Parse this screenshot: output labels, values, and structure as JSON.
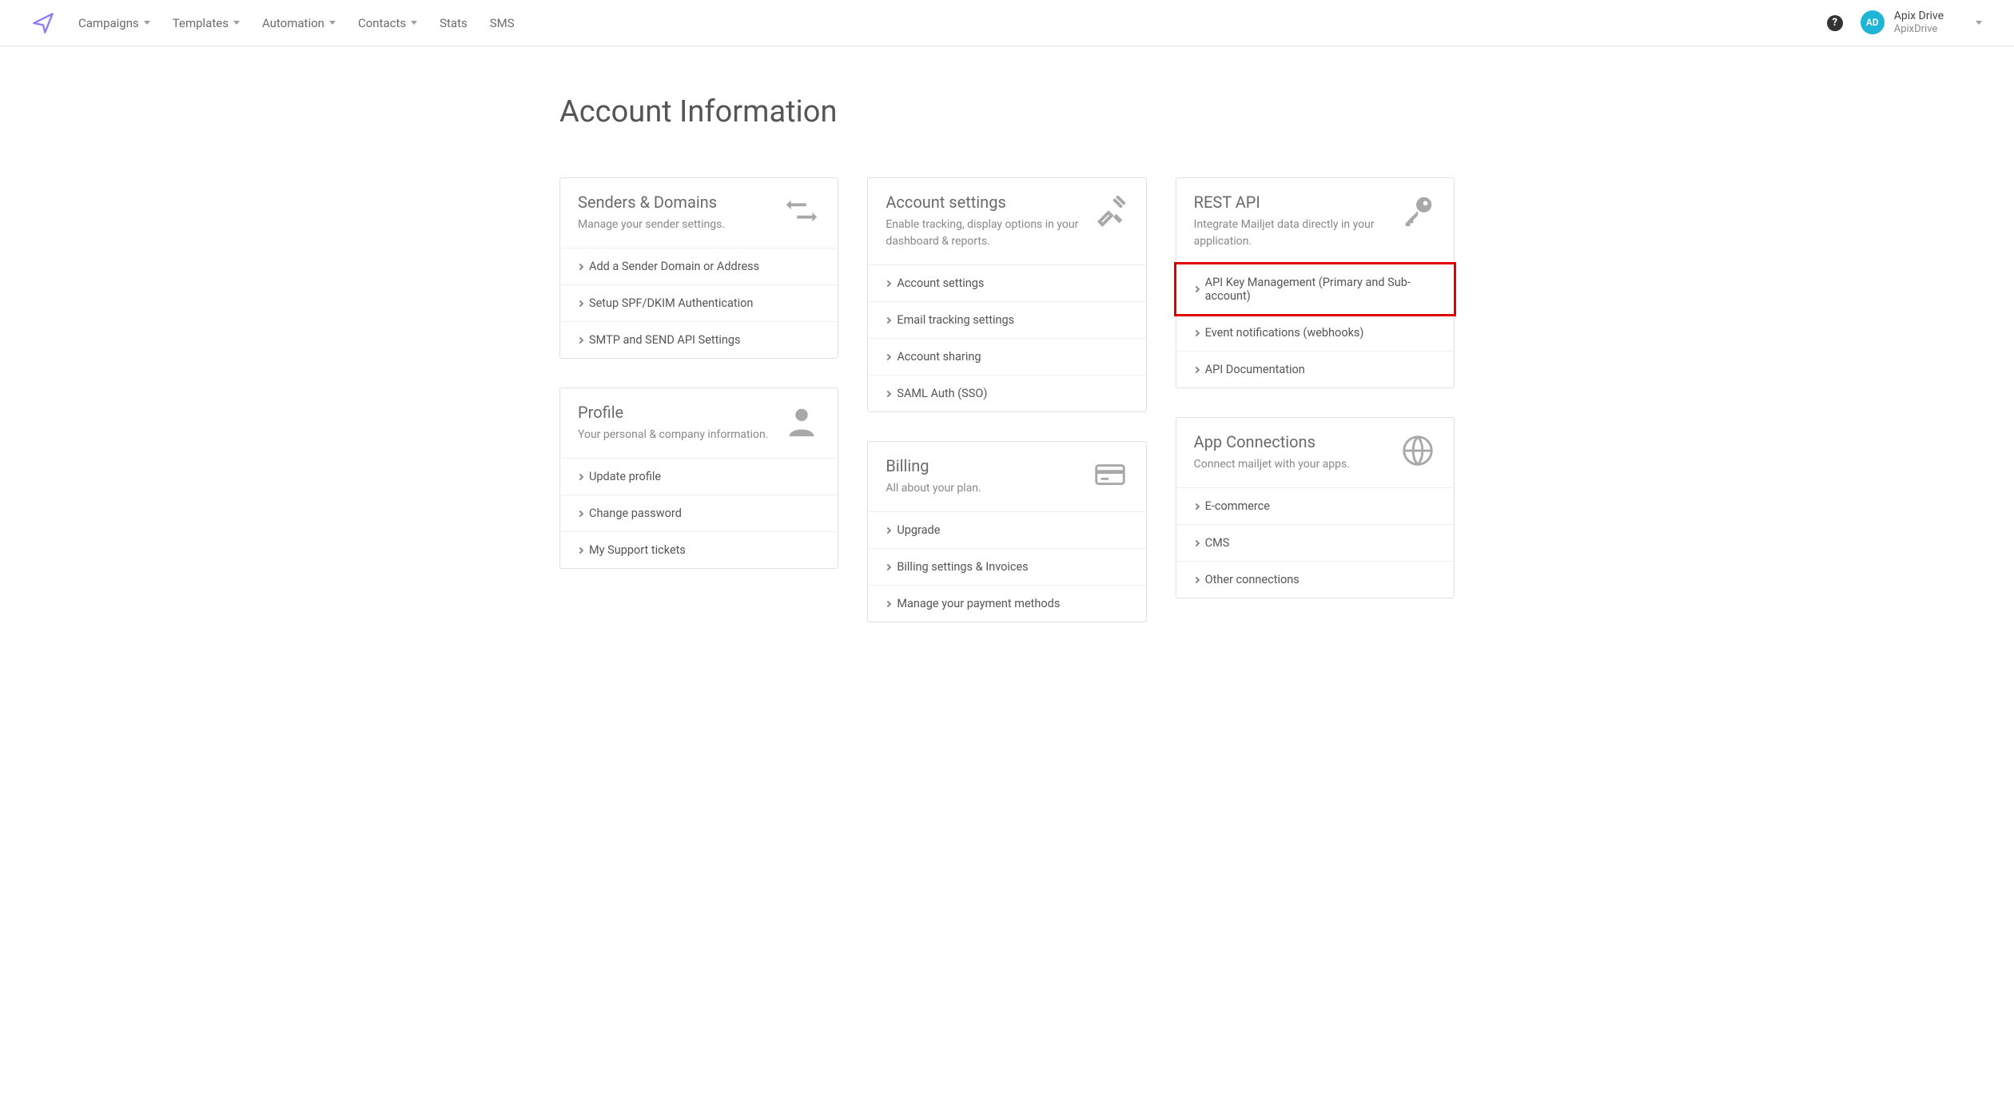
{
  "nav": {
    "items": [
      {
        "label": "Campaigns",
        "dropdown": true
      },
      {
        "label": "Templates",
        "dropdown": true
      },
      {
        "label": "Automation",
        "dropdown": true
      },
      {
        "label": "Contacts",
        "dropdown": true
      },
      {
        "label": "Stats",
        "dropdown": false
      },
      {
        "label": "SMS",
        "dropdown": false
      }
    ]
  },
  "user": {
    "avatar_initials": "AD",
    "name": "Apix Drive",
    "org": "ApixDrive"
  },
  "page": {
    "title": "Account Information"
  },
  "cards": {
    "senders": {
      "title": "Senders & Domains",
      "desc": "Manage your sender settings.",
      "links": [
        "Add a Sender Domain or Address",
        "Setup SPF/DKIM Authentication",
        "SMTP and SEND API Settings"
      ]
    },
    "profile": {
      "title": "Profile",
      "desc": "Your personal & company information.",
      "links": [
        "Update profile",
        "Change password",
        "My Support tickets"
      ]
    },
    "account": {
      "title": "Account settings",
      "desc": "Enable tracking, display options in your dashboard & reports.",
      "links": [
        "Account settings",
        "Email tracking settings",
        "Account sharing",
        "SAML Auth (SSO)"
      ]
    },
    "billing": {
      "title": "Billing",
      "desc": "All about your plan.",
      "links": [
        "Upgrade",
        "Billing settings & Invoices",
        "Manage your payment methods"
      ]
    },
    "restapi": {
      "title": "REST API",
      "desc": "Integrate Mailjet data directly in your application.",
      "links": [
        "API Key Management (Primary and Sub-account)",
        "Event notifications (webhooks)",
        "API Documentation"
      ]
    },
    "appconn": {
      "title": "App Connections",
      "desc": "Connect mailjet with your apps.",
      "links": [
        "E-commerce",
        "CMS",
        "Other connections"
      ]
    }
  }
}
